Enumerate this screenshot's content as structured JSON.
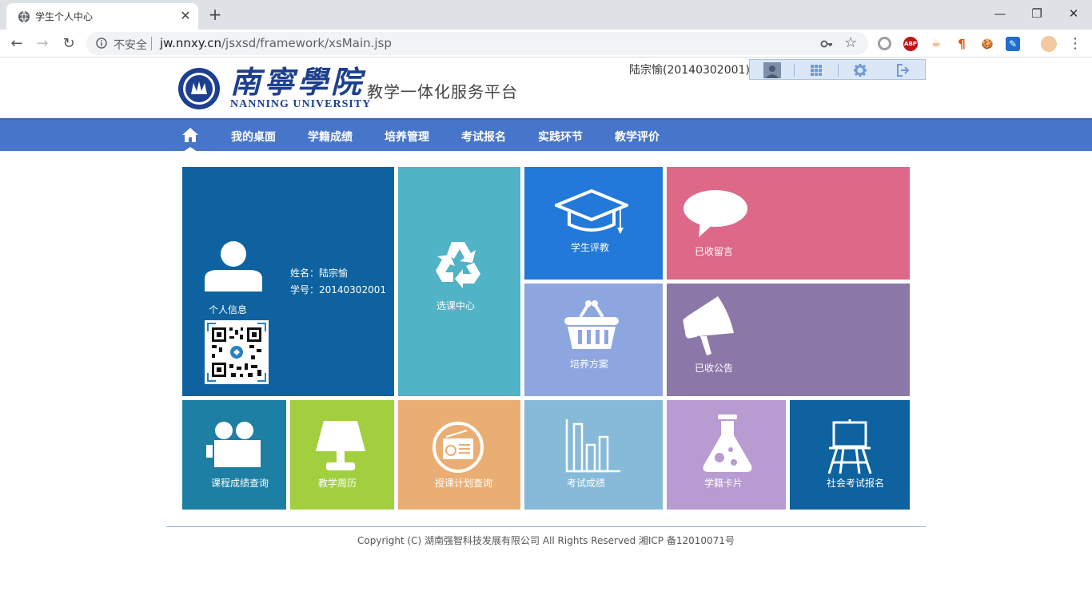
{
  "browser": {
    "tab_title": "学生个人中心",
    "tab_close": "✕",
    "new_tab": "+",
    "insecure_label": "不安全",
    "url_host": "jw.nnxy.cn",
    "url_path": "/jsxsd/framework/xsMain.jsp",
    "win_min": "—",
    "win_max": "❐",
    "win_close": "✕",
    "back": "←",
    "forward": "→",
    "reload": "↻",
    "star": "☆",
    "extensions": [
      {
        "name": "circle-extension-icon",
        "label": "",
        "color": "#9e9e9e"
      },
      {
        "name": "abp-extension-icon",
        "label": "ABP",
        "color": "#c0141b"
      },
      {
        "name": "java-extension-icon",
        "label": "☕",
        "color": "#ffffff"
      },
      {
        "name": "paragraph-extension-icon",
        "label": "¶",
        "color": "#ffffff"
      },
      {
        "name": "cookie-extension-icon",
        "label": "🍪",
        "color": "#ffffff"
      },
      {
        "name": "edit-extension-icon",
        "label": "✎",
        "color": "#1f6fd1"
      },
      {
        "name": "profile-avatar-icon",
        "label": "",
        "color": "#f2c9a0"
      }
    ],
    "menu": "⋮"
  },
  "header": {
    "school_cn": "南寧學院",
    "school_en": "NANNING UNIVERSITY",
    "platform": "教学一体化服务平台",
    "user": "陆宗愉(20140302001)"
  },
  "nav": {
    "items": [
      "我的桌面",
      "学籍成绩",
      "培养管理",
      "考试报名",
      "实践环节",
      "教学评价"
    ]
  },
  "tiles": {
    "profile": {
      "label": "个人信息",
      "name_line": "姓名：陆宗愉",
      "id_line": "学号：20140302001",
      "color": "#0e62a0"
    },
    "course_select": {
      "label": "选课中心",
      "color": "#50b3c6"
    },
    "evaluation": {
      "label": "学生评教",
      "color": "#2279d9"
    },
    "messages": {
      "label": "已收留言",
      "color": "#dd6888"
    },
    "training_plan": {
      "label": "培养方案",
      "color": "#8ea6e0"
    },
    "notices": {
      "label": "已收公告",
      "color": "#8c77a9"
    },
    "course_grades": {
      "label": "课程成绩查询",
      "color": "#1d7fa3"
    },
    "calendar": {
      "label": "教学周历",
      "color": "#a2cf3e"
    },
    "lesson_plan": {
      "label": "授课计划查询",
      "color": "#eaae74"
    },
    "exam_grades": {
      "label": "考试成绩",
      "color": "#86bad8"
    },
    "student_card": {
      "label": "学籍卡片",
      "color": "#b89bd1"
    },
    "social_exam": {
      "label": "社会考试报名",
      "color": "#0e62a0"
    }
  },
  "footer": {
    "text": "Copyright (C) 湖南强智科技发展有限公司 All Rights Reserved 湘ICP 备12010071号"
  }
}
